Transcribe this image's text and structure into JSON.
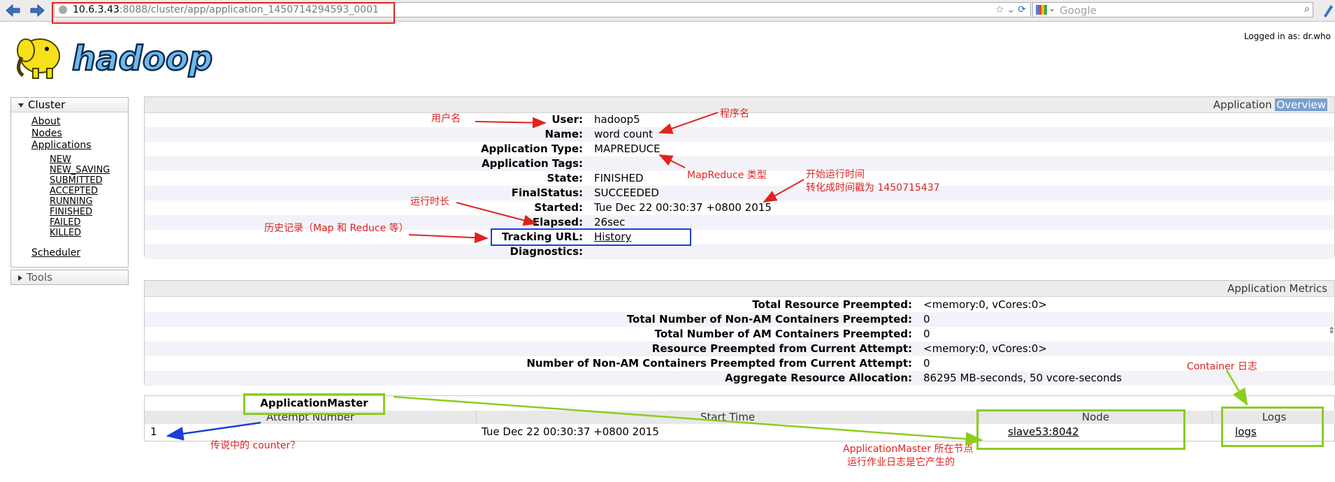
{
  "browser": {
    "url_host": "10.6.3.43",
    "url_rest": ":8088/cluster/app/application_1450714294593_0001",
    "search_placeholder": "Google"
  },
  "header": {
    "logged_in": "Logged in as: dr.who",
    "logo_text": "hadoop"
  },
  "sidebar": {
    "cluster_title": "Cluster",
    "links": [
      "About",
      "Nodes",
      "Applications"
    ],
    "app_states": [
      "NEW",
      "NEW_SAVING",
      "SUBMITTED",
      "ACCEPTED",
      "RUNNING",
      "FINISHED",
      "FAILED",
      "KILLED"
    ],
    "scheduler": "Scheduler",
    "tools_title": "Tools"
  },
  "overview": {
    "title_prefix": "Application",
    "title_highlight": "Overview",
    "fields": [
      {
        "label": "User:",
        "value": "hadoop5"
      },
      {
        "label": "Name:",
        "value": "word count"
      },
      {
        "label": "Application Type:",
        "value": "MAPREDUCE"
      },
      {
        "label": "Application Tags:",
        "value": ""
      },
      {
        "label": "State:",
        "value": "FINISHED"
      },
      {
        "label": "FinalStatus:",
        "value": "SUCCEEDED"
      },
      {
        "label": "Started:",
        "value": "Tue Dec 22 00:30:37 +0800 2015"
      },
      {
        "label": "Elapsed:",
        "value": "26sec"
      },
      {
        "label": "Tracking URL:",
        "value": "History"
      },
      {
        "label": "Diagnostics:",
        "value": ""
      }
    ]
  },
  "metrics": {
    "title": "Application Metrics",
    "fields": [
      {
        "label": "Total Resource Preempted:",
        "value": "<memory:0, vCores:0>"
      },
      {
        "label": "Total Number of Non-AM Containers Preempted:",
        "value": "0"
      },
      {
        "label": "Total Number of AM Containers Preempted:",
        "value": "0"
      },
      {
        "label": "Resource Preempted from Current Attempt:",
        "value": "<memory:0, vCores:0>"
      },
      {
        "label": "Number of Non-AM Containers Preempted from Current Attempt:",
        "value": "0"
      },
      {
        "label": "Aggregate Resource Allocation:",
        "value": "86295 MB-seconds, 50 vcore-seconds"
      }
    ]
  },
  "am": {
    "title": "ApplicationMaster",
    "columns": [
      "Attempt Number",
      "Start Time",
      "Node",
      "Logs"
    ],
    "rows": [
      {
        "attempt": "1",
        "start": "Tue Dec 22 00:30:37 +0800 2015",
        "node": "slave53:8042",
        "logs": "logs"
      }
    ]
  },
  "annotations": {
    "user": "用户名",
    "name": "程序名",
    "type": "MapReduce 类型",
    "start_1": "开始运行时间",
    "start_2": "转化成时间戳为 1450715437",
    "elapsed": "运行时长",
    "history": "历史记录（Map 和 Reduce 等）",
    "container": "Container 日志",
    "counter": "传说中的 counter？",
    "node_1": "ApplicationMaster 所在节点",
    "node_2": "运行作业日志是它产生的"
  },
  "colors": {
    "annotation_red": "#e0231f",
    "annotation_blue": "#1b3fd4",
    "annotation_green": "#8ccc1f",
    "highlight": "#7b9fcf"
  }
}
